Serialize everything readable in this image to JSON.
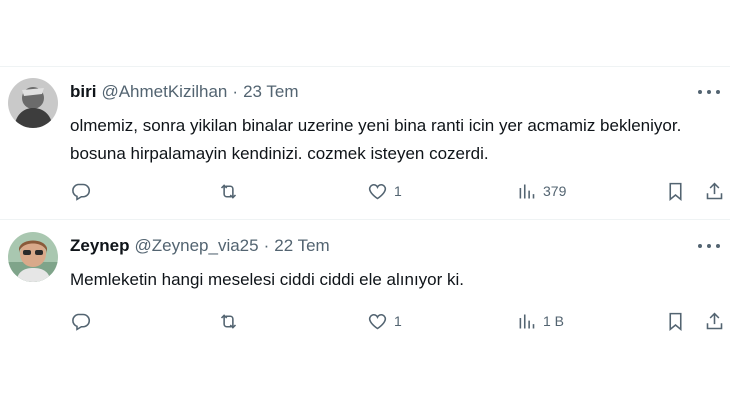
{
  "tweets": [
    {
      "name": "biri",
      "handle": "@AhmetKizilhan",
      "separator": "·",
      "date": "23 Tem",
      "text": "olmemiz, sonra yikilan binalar uzerine yeni bina ranti icin yer acmamiz bekleniyor. bosuna hirpalamayin kendinizi. cozmek isteyen cozerdi.",
      "likes": "1",
      "views": "379"
    },
    {
      "name": "Zeynep",
      "handle": "@Zeynep_via25",
      "separator": "·",
      "date": "22 Tem",
      "text": "Memleketin hangi meselesi ciddi ciddi ele alınıyor ki.",
      "likes": "1",
      "views": "1 B"
    }
  ],
  "colors": {
    "text_primary": "#0f1419",
    "text_secondary": "#536471",
    "divider": "#eff3f4"
  },
  "icons": [
    "reply-icon",
    "retweet-icon",
    "like-icon",
    "views-icon",
    "bookmark-icon",
    "share-icon",
    "more-icon"
  ]
}
